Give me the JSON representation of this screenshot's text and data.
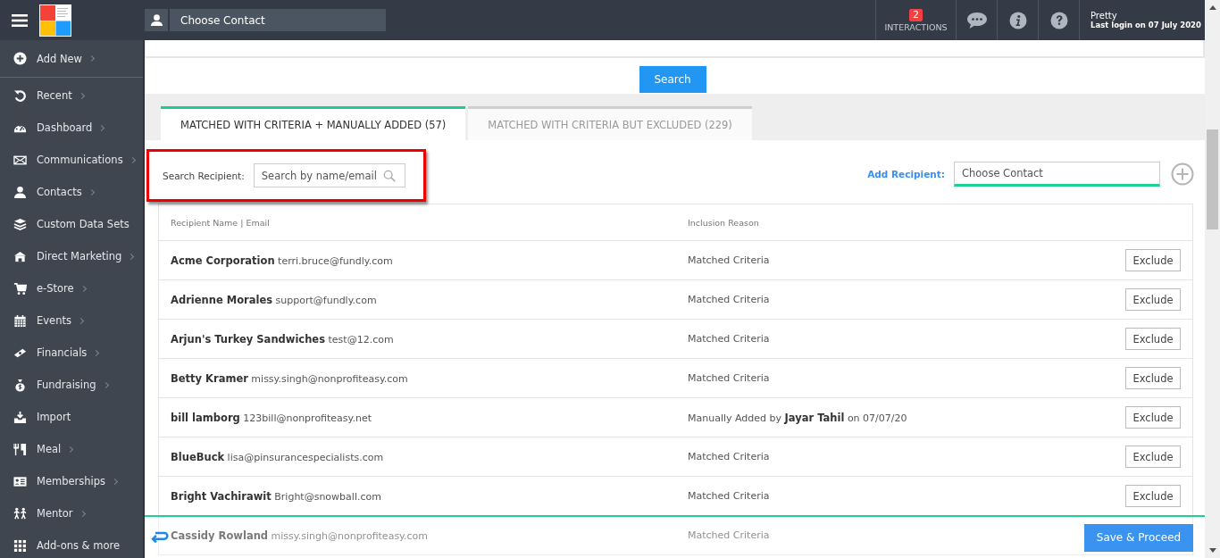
{
  "topbar": {
    "contact_field": {
      "placeholder": "Choose Contact"
    },
    "interactions": {
      "count": "2",
      "label": "INTERACTIONS"
    },
    "user": {
      "name": "Pretty",
      "last_login": "Last login on 07 July 2020"
    }
  },
  "sidebar": {
    "items": [
      {
        "label": "Add New",
        "submenu": true
      },
      {
        "label": "Recent",
        "submenu": true
      },
      {
        "label": "Dashboard",
        "submenu": true
      },
      {
        "label": "Communications",
        "submenu": true
      },
      {
        "label": "Contacts",
        "submenu": true
      },
      {
        "label": "Custom Data Sets",
        "submenu": false
      },
      {
        "label": "Direct Marketing",
        "submenu": true
      },
      {
        "label": "e-Store",
        "submenu": true
      },
      {
        "label": "Events",
        "submenu": true
      },
      {
        "label": "Financials",
        "submenu": true
      },
      {
        "label": "Fundraising",
        "submenu": true
      },
      {
        "label": "Import",
        "submenu": false
      },
      {
        "label": "Meal",
        "submenu": true
      },
      {
        "label": "Memberships",
        "submenu": true
      },
      {
        "label": "Mentor",
        "submenu": true
      },
      {
        "label": "Add-ons & more",
        "submenu": false
      }
    ]
  },
  "search_button": "Search",
  "tabs": [
    {
      "label": "MATCHED WITH CRITERIA + MANUALLY ADDED (57)",
      "selected": true
    },
    {
      "label": "MATCHED WITH CRITERIA BUT EXCLUDED (229)",
      "selected": false
    }
  ],
  "search_recipient": {
    "label": "Search Recipient:",
    "placeholder": "Search by name/email"
  },
  "add_recipient": {
    "label": "Add Recipient:",
    "placeholder": "Choose Contact"
  },
  "table": {
    "columns": [
      "Recipient Name | Email",
      "Inclusion Reason"
    ],
    "rows": [
      {
        "recipient": "**Acme Corporation** terri.bruce@fundly.com",
        "reason": "Matched Criteria",
        "action": "Exclude"
      },
      {
        "recipient": "**Adrienne Morales** support@fundly.com",
        "reason": "Matched Criteria",
        "action": "Exclude"
      },
      {
        "recipient": "**Arjun's Turkey Sandwiches** test@12.com",
        "reason": "Matched Criteria",
        "action": "Exclude"
      },
      {
        "recipient": "**Betty Kramer** missy.singh@nonprofiteasy.com",
        "reason": "Matched Criteria",
        "action": "Exclude"
      },
      {
        "recipient": "**bill lamborg** 123bill@nonprofiteasy.net",
        "reason": "Manually Added by **Jayar Tahil** on 07/07/20",
        "action": "Exclude"
      },
      {
        "recipient": "**BlueBuck** lisa@pinsurancespecialists.com",
        "reason": "Matched Criteria",
        "action": "Exclude"
      },
      {
        "recipient": "**Bright Vachirawit** Bright@snowball.com",
        "reason": "Matched Criteria",
        "action": "Exclude"
      },
      {
        "recipient": "**Cassidy Rowland** missy.singh@nonprofiteasy.com",
        "reason": "Matched Criteria"
      }
    ]
  },
  "footer": {
    "save_button": "Save & Proceed"
  }
}
